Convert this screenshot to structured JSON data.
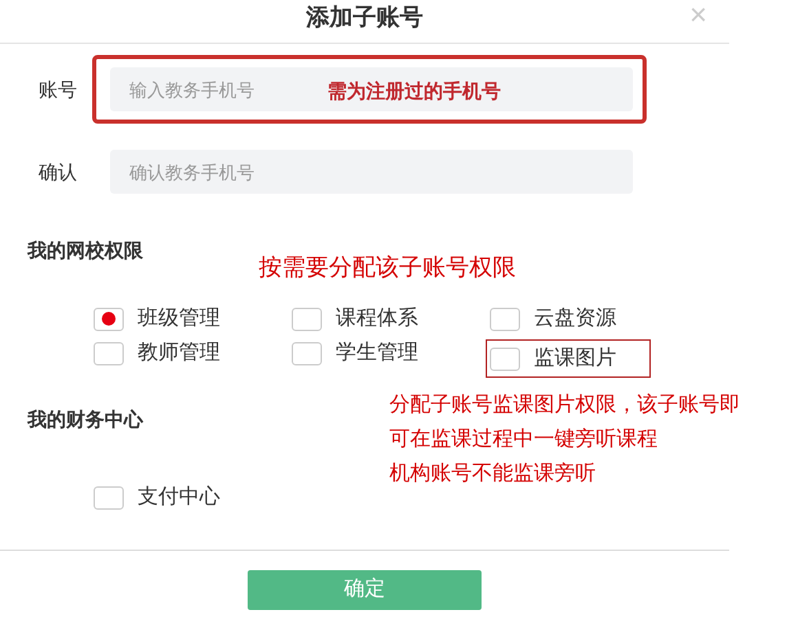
{
  "dialog": {
    "title": "添加子账号",
    "close": "×"
  },
  "fields": [
    {
      "label": "账号",
      "placeholder": "输入教务手机号",
      "highlighted": true,
      "note": "需为注册过的手机号"
    },
    {
      "label": "确认",
      "placeholder": "确认教务手机号",
      "highlighted": false
    }
  ],
  "sections": [
    {
      "title": "我的网校权限",
      "items": [
        {
          "label": "班级管理",
          "checked": true,
          "highlighted": false
        },
        {
          "label": "课程体系",
          "checked": false,
          "highlighted": false
        },
        {
          "label": "云盘资源",
          "checked": false,
          "highlighted": false
        },
        {
          "label": "教师管理",
          "checked": false,
          "highlighted": false
        },
        {
          "label": "学生管理",
          "checked": false,
          "highlighted": false
        },
        {
          "label": "监课图片",
          "checked": false,
          "highlighted": true
        }
      ]
    },
    {
      "title": "我的财务中心",
      "items": [
        {
          "label": "支付中心",
          "checked": false,
          "highlighted": false
        }
      ]
    }
  ],
  "annotations": [
    {
      "text": "按需要分配该子账号权限"
    },
    {
      "text": "分配子账号监课图片权限，该子账号即"
    },
    {
      "text": "可在监课过程中一键旁听课程"
    },
    {
      "text": "机构账号不能监课旁听"
    }
  ],
  "submit": "确定"
}
